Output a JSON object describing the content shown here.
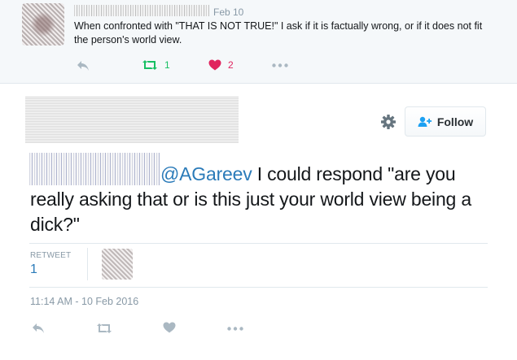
{
  "parent_tweet": {
    "date": "Feb 10",
    "text": "When confronted with \"THAT IS NOT TRUE!\" I ask if it is factually wrong, or if it does not fit the person's world view.",
    "retweet_count": "1",
    "like_count": "2",
    "icons": [
      "reply-icon",
      "retweet-icon",
      "heart-icon",
      "more-icon"
    ]
  },
  "main_tweet": {
    "follow_label": "Follow",
    "mention": "@AGareev",
    "text": " I could respond \"are you really asking that or is this just your world view being a dick?\"",
    "stats_label": "RETWEET",
    "stats_count": "1",
    "timestamp": "11:14 AM - 10 Feb 2016",
    "icons": [
      "settings-gear-icon",
      "follow-person-icon",
      "reply-icon",
      "retweet-icon",
      "heart-icon",
      "more-icon"
    ]
  },
  "colors": {
    "retweet_green": "#17bf63",
    "like_red": "#e0245e",
    "link_blue": "#2b7bb9",
    "muted_gray": "#8899a6",
    "parent_bg": "#f5f8fa"
  }
}
